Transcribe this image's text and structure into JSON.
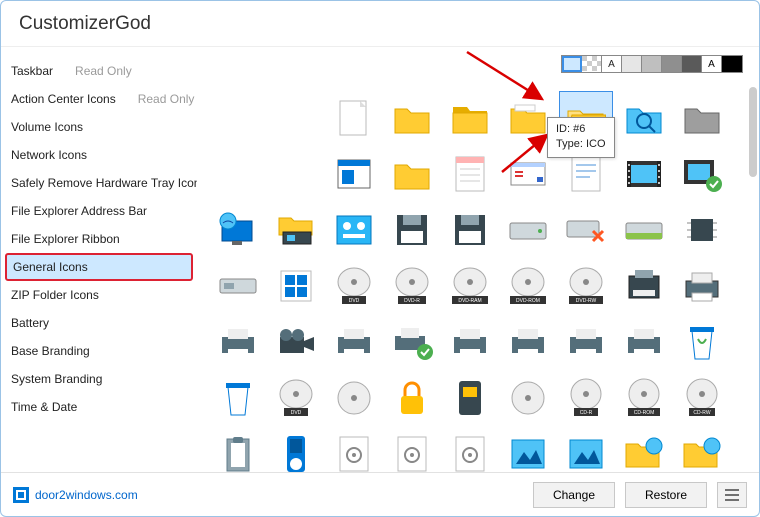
{
  "title": "CustomizerGod",
  "sidebar": {
    "items": [
      {
        "label": "Taskbar",
        "note": "Read Only"
      },
      {
        "label": "Action Center Icons",
        "note": "Read Only"
      },
      {
        "label": "Volume Icons",
        "note": ""
      },
      {
        "label": "Network Icons",
        "note": ""
      },
      {
        "label": "Safely Remove Hardware Tray Icon",
        "note": ""
      },
      {
        "label": "File Explorer Address Bar",
        "note": ""
      },
      {
        "label": "File Explorer Ribbon",
        "note": ""
      },
      {
        "label": "General Icons",
        "note": ""
      },
      {
        "label": "ZIP Folder Icons",
        "note": ""
      },
      {
        "label": "Battery",
        "note": ""
      },
      {
        "label": "Base Branding",
        "note": ""
      },
      {
        "label": "System Branding",
        "note": ""
      },
      {
        "label": "Time & Date",
        "note": ""
      }
    ],
    "selected_index": 7
  },
  "swatches": {
    "selected_index": 0,
    "items": [
      {
        "bg": "#cde8ff",
        "text": ""
      },
      {
        "bg": "checker",
        "text": ""
      },
      {
        "bg": "#ffffff",
        "text": "A"
      },
      {
        "bg": "#e6e6e6",
        "text": ""
      },
      {
        "bg": "#bfbfbf",
        "text": ""
      },
      {
        "bg": "#8f8f8f",
        "text": ""
      },
      {
        "bg": "#5a5a5a",
        "text": ""
      },
      {
        "bg": "#ffffff",
        "text": "A",
        "fg": "#000"
      },
      {
        "bg": "#000000",
        "text": ""
      }
    ]
  },
  "selected_icon_index": 4,
  "tooltip": {
    "line1": "ID: #6",
    "line2": "Type: ICO"
  },
  "footer": {
    "link_text": "door2windows.com",
    "change_label": "Change",
    "restore_label": "Restore"
  }
}
